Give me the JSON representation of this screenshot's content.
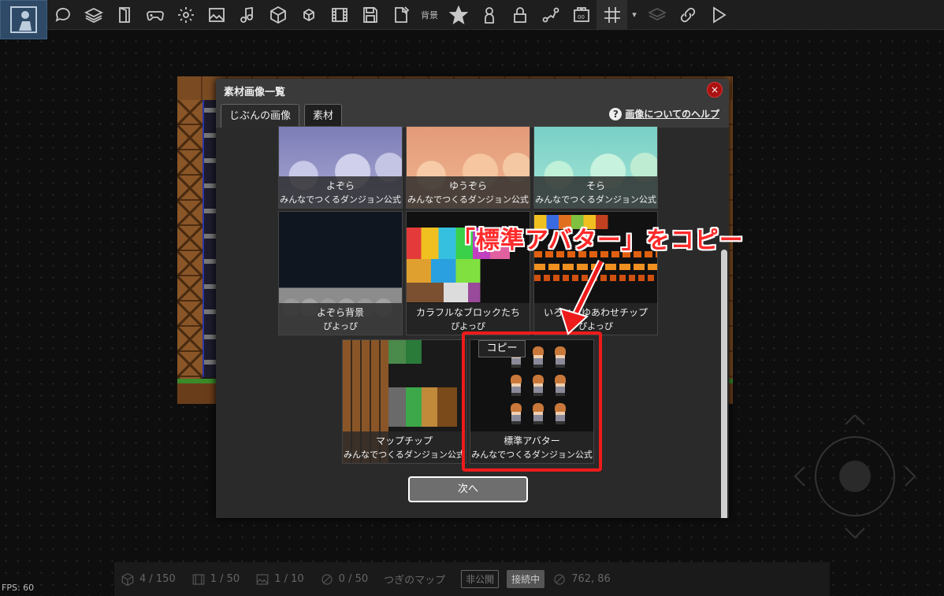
{
  "toolbar": {
    "logo_icon": "puzzle-person-icon",
    "items": [
      {
        "icon": "speech-bubble-icon"
      },
      {
        "icon": "layers-icon"
      },
      {
        "icon": "door-icon"
      },
      {
        "icon": "gamepad-icon"
      },
      {
        "icon": "gear-icon"
      },
      {
        "icon": "image-icon"
      },
      {
        "icon": "music-note-icon"
      },
      {
        "icon": "cube-icon"
      },
      {
        "icon": "small-cube-icon"
      },
      {
        "icon": "film-icon"
      },
      {
        "icon": "save-icon"
      },
      {
        "icon": "export-icon"
      }
    ],
    "bg_label": "背景",
    "items2": [
      {
        "icon": "star-icon"
      },
      {
        "icon": "person-icon"
      },
      {
        "icon": "lock-icon"
      },
      {
        "icon": "route-icon"
      },
      {
        "icon": "counter-icon"
      },
      {
        "icon": "grid-icon"
      }
    ],
    "caret": "▾"
  },
  "modal": {
    "title": "素材画像一覧",
    "close": "×",
    "tabs": [
      {
        "label": "じぶんの画像"
      },
      {
        "label": "素材"
      }
    ],
    "help_text": "画像についてのヘルプ",
    "help_icon": "?",
    "tiles": [
      {
        "title": "よぞら",
        "author": "みんなでつくるダンジョン公式",
        "art": "art-sky1"
      },
      {
        "title": "ゆうぞら",
        "author": "みんなでつくるダンジョン公式",
        "art": "art-sky2"
      },
      {
        "title": "そら",
        "author": "みんなでつくるダンジョン公式",
        "art": "art-sky3"
      },
      {
        "title": "よぞら背景",
        "author": "ぴよっぴ",
        "art": "art-night"
      },
      {
        "title": "カラフルなブロックたち",
        "author": "ぴよっぴ",
        "art": "art-blocks"
      },
      {
        "title": "いろいろゆあわせチップ",
        "author": "ぴよっぴ",
        "art": "art-chips"
      },
      {
        "title": "マップチップ",
        "author": "みんなでつくるダンジョン公式",
        "art": "art-mapchip"
      },
      {
        "title": "標準アバター",
        "author": "みんなでつくるダンジョン公式",
        "art": "art-avatar"
      }
    ],
    "copy_label": "コピー",
    "next_button": "次へ"
  },
  "annotation": "「標準アバター」をコピー",
  "accent_color": "#ee1b1b",
  "status": {
    "items": [
      {
        "icon": "cube-icon",
        "value": "4 / 150"
      },
      {
        "icon": "film-icon",
        "value": "1 / 50"
      },
      {
        "icon": "image-icon",
        "value": "1 / 10"
      },
      {
        "icon": "no-entry-icon",
        "value": "0 / 50"
      },
      {
        "icon": "",
        "value": "つぎのマップ"
      }
    ],
    "private_badge": "非公開",
    "connected_badge": "接続中",
    "coords": "762, 86"
  },
  "fps": "FPS: 60"
}
